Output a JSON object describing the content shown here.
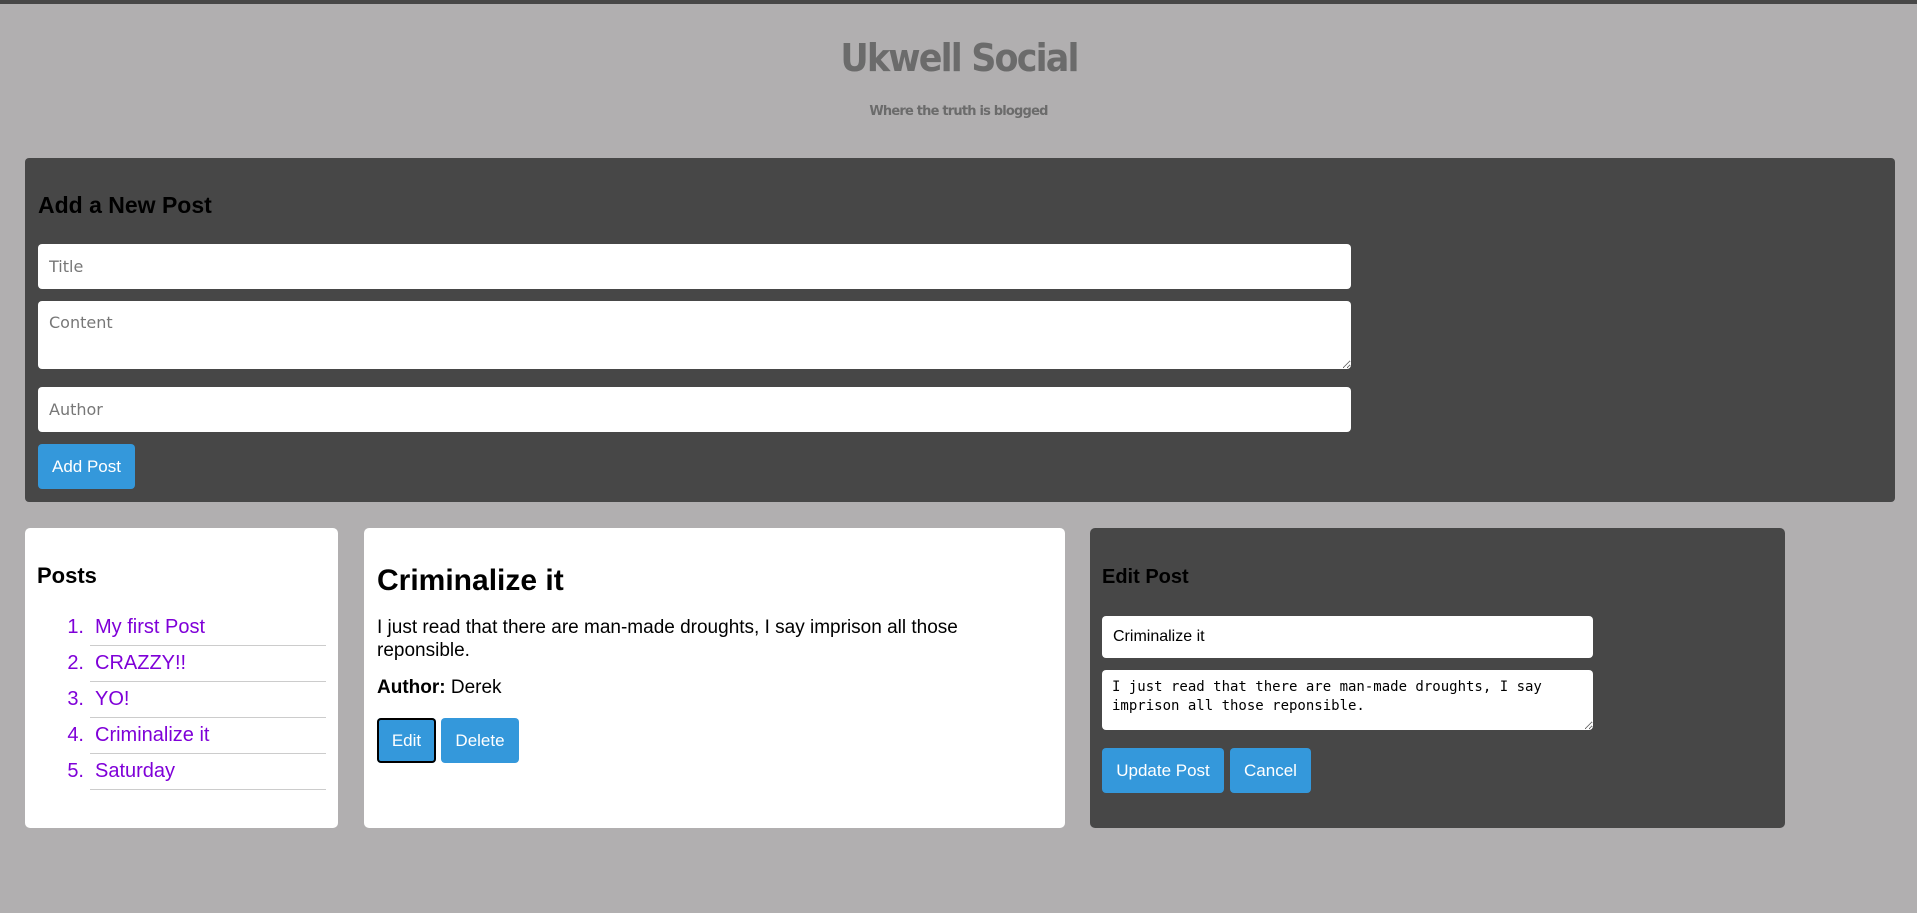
{
  "header": {
    "title": "Ukwell Social",
    "tagline": "Where the truth is blogged"
  },
  "add_post": {
    "heading": "Add a New Post",
    "title_placeholder": "Title",
    "content_placeholder": "Content",
    "author_placeholder": "Author",
    "button_label": "Add Post"
  },
  "posts": {
    "heading": "Posts",
    "items": [
      {
        "number": "1.",
        "title": "My first Post"
      },
      {
        "number": "2.",
        "title": "CRAZZY!!"
      },
      {
        "number": "3.",
        "title": "YO!"
      },
      {
        "number": "4.",
        "title": "Criminalize it"
      },
      {
        "number": "5.",
        "title": "Saturday"
      }
    ]
  },
  "post_detail": {
    "title": "Criminalize it",
    "content": "I just read that there are man-made droughts, I say imprison all those reponsible.",
    "author_label": "Author:",
    "author": "Derek",
    "edit_label": "Edit",
    "delete_label": "Delete"
  },
  "edit_post": {
    "heading": "Edit Post",
    "title_value": "Criminalize it",
    "content_value": "I just read that there are man-made droughts, I say imprison all those reponsible.",
    "update_label": "Update Post",
    "cancel_label": "Cancel"
  },
  "colors": {
    "background": "#b1afb0",
    "panel_dark": "#474747",
    "accent": "#3498db",
    "link": "#7f00d8"
  }
}
